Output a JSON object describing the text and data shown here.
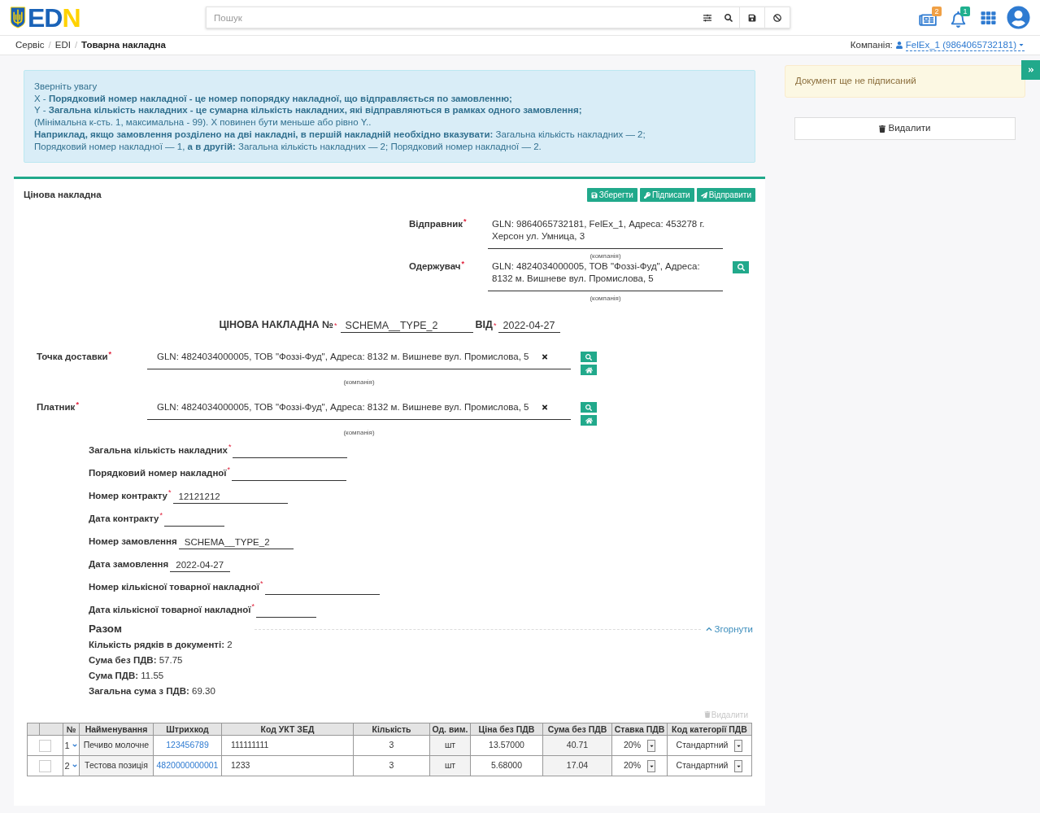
{
  "header": {
    "logo_text": [
      "ED",
      "N"
    ],
    "search": {
      "placeholder": "Пошук"
    },
    "icons": [
      {
        "kind": "news",
        "badge": "2",
        "color": "#f0a045"
      },
      {
        "kind": "notifications",
        "badge": "1",
        "color": "#1fb08e"
      },
      {
        "kind": "apps"
      },
      {
        "kind": "profile"
      }
    ]
  },
  "breadcrumbs": {
    "separator": "/",
    "items": [
      {
        "label": "Сервіс",
        "current": false
      },
      {
        "label": "EDI",
        "current": false
      },
      {
        "label": "Товарна накладна",
        "current": true
      }
    ]
  },
  "company": {
    "label": "Компанія:",
    "value": "FelEx_1 (9864065732181)"
  },
  "required_mark": "*",
  "notice": {
    "title": "Зверніть увагу",
    "lines": [
      "X - **Порядковий номер накладної - це номер попорядку накладної, що відправляється по замовленню;**",
      "Y - **Загальна кількість накладних - це сумарна кількість накладних, які відправляються в рамках одного замовлення;**",
      "(Мінімальна к-сть. 1, максимальна - 99). X повинен бути меньше або рівно Y..",
      "**Наприклад, якщо замовлення розділено на дві накладні, в першій накладній необхідно вказувати:** Загальна кількість накладних — 2;",
      "Порядковий номер накладної — 1, **а в другій:** Загальна кількість накладних — 2; Порядковий номер накладної — 2."
    ]
  },
  "form": {
    "title": "Цінова накладна",
    "actions": [
      {
        "kind": "save",
        "label": "Зберегти"
      },
      {
        "kind": "sign",
        "label": "Підписати"
      },
      {
        "kind": "send",
        "label": "Відправити"
      }
    ],
    "parties": [
      {
        "label": "Відправник",
        "required": true,
        "value": "GLN: 9864065732181, FelEx_1, Адреса: 453278 г. Херсон ул. Умница, 3",
        "caption": "(компанія)",
        "searchable": false
      },
      {
        "label": "Одержувач",
        "required": true,
        "value": "GLN: 4824034000005, ТОВ \"Фоззі-Фуд\", Адреса: 8132 м. Вишневе вул. Промислова, 5",
        "caption": "(компанія)",
        "searchable": true
      }
    ],
    "document": {
      "title": "ЦІНОВА НАКЛАДНА №",
      "number": "SCHEMA__TYPE_2",
      "date_label": "ВІД",
      "date": "2022-04-27"
    },
    "locations": [
      {
        "label": "Точка доставки",
        "required": true,
        "value": "GLN: 4824034000005, ТОВ \"Фоззі-Фуд\", Адреса: 8132 м. Вишневе вул. Промислова, 5",
        "caption": "(компанія)"
      },
      {
        "label": "Платник",
        "required": true,
        "value": "GLN: 4824034000005, ТОВ \"Фоззі-Фуд\", Адреса: 8132 м. Вишневе вул. Промислова, 5",
        "caption": "(компанія)"
      }
    ],
    "fields": [
      {
        "label": "Загальна кількість накладних",
        "required": true,
        "kind": "text"
      },
      {
        "label": "Порядковий номер накладної",
        "required": true,
        "kind": "text"
      },
      {
        "label": "Номер контракту",
        "required": true,
        "kind": "text",
        "value": "12121212"
      },
      {
        "label": "Дата контракту",
        "required": true,
        "kind": "date"
      },
      {
        "label": "Номер замовлення",
        "required": false,
        "kind": "text",
        "value": "SCHEMA__TYPE_2"
      },
      {
        "label": "Дата замовлення",
        "required": false,
        "kind": "date",
        "value": "2022-04-27"
      },
      {
        "label": "Номер кількісної товарної накладної",
        "required": true,
        "kind": "text"
      },
      {
        "label": "Дата кількісної товарної накладної",
        "required": true,
        "kind": "date"
      }
    ],
    "totals": {
      "title": "Разом",
      "toggle": "Згорнути",
      "rows": [
        {
          "label": "Кількість рядків в документі:",
          "value": "2"
        },
        {
          "label": "Сума без ПДВ:",
          "value": "57.75"
        },
        {
          "label": "Сума ПДВ:",
          "value": "11.55"
        },
        {
          "label": "Загальна сума з ПДВ:",
          "value": "69.30"
        }
      ]
    },
    "delete_rows": {
      "label": "Видалити",
      "disabled": true
    },
    "table": {
      "columns": [
        {
          "label": "№",
          "kind": "index"
        },
        {
          "label": "Найменування",
          "kind": "text"
        },
        {
          "label": "Штрихкод",
          "kind": "link"
        },
        {
          "label": "Код УКТ ЗЕД",
          "kind": "code"
        },
        {
          "label": "Кількість",
          "kind": "number"
        },
        {
          "label": "Од. вим.",
          "kind": "text"
        },
        {
          "label": "Ціна без ПДВ",
          "kind": "number"
        },
        {
          "label": "Сума без ПДВ",
          "kind": "text"
        },
        {
          "label": "Ставка ПДВ",
          "kind": "select"
        },
        {
          "label": "Код категорії ПДВ",
          "kind": "select"
        }
      ],
      "rows": [
        {
          "selected": false,
          "cells": [
            "1",
            "Печиво молочне",
            "123456789",
            "111111111",
            "3",
            "шт",
            "13.57000",
            "40.71",
            "20%",
            "Стандартний"
          ]
        },
        {
          "selected": false,
          "cells": [
            "2",
            "Тестова позиція",
            "4820000000001",
            "1233",
            "3",
            "шт",
            "5.68000",
            "17.04",
            "20%",
            "Стандартний"
          ]
        }
      ]
    }
  },
  "sidebar": {
    "status": "Документ ще не підписаний",
    "delete_label": "Видалити"
  }
}
